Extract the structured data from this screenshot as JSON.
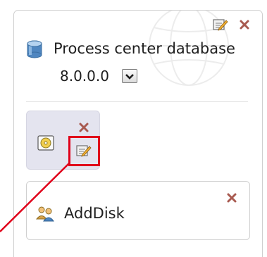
{
  "database": {
    "label": "Process center database",
    "version": "8.0.0.0",
    "icon": "database-icon"
  },
  "top_actions": {
    "edit_icon": "edit-icon",
    "close_icon": "close-icon"
  },
  "disk": {
    "icon": "disk-icon",
    "edit_icon": "edit-icon",
    "close_icon": "close-icon"
  },
  "step": {
    "label": "AddDisk",
    "icon": "people-icon",
    "close_icon": "close-icon"
  },
  "colors": {
    "highlight": "#e0001a",
    "tile": "#e4e4ef",
    "close": "#a85a50"
  }
}
